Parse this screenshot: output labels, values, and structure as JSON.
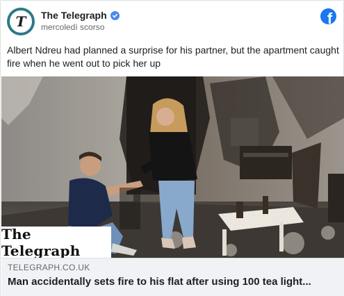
{
  "post": {
    "page_name": "The Telegraph",
    "timestamp": "mercoledì scorso",
    "text": "Albert Ndreu had planned a surprise for his partner, but the apartment caught fire when he went out to pick her up",
    "verified": true
  },
  "avatar": {
    "letter": "T",
    "icon": "telegraph-logo-icon"
  },
  "platform": {
    "icon": "facebook-icon",
    "color": "#1877f2"
  },
  "photo": {
    "brand_overlay": "The Telegraph"
  },
  "link_preview": {
    "domain": "TELEGRAPH.CO.UK",
    "title": "Man accidentally sets fire to his flat after using 100 tea light..."
  },
  "colors": {
    "accent": "#1877f2",
    "verified": "#4a88f0",
    "avatar_ring": "#2b7a87",
    "preview_bg": "#f0f2f5"
  }
}
